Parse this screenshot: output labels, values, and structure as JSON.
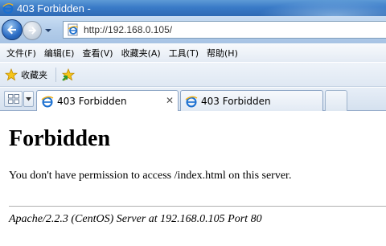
{
  "window": {
    "title": "403 Forbidden -"
  },
  "navigation": {
    "url": "http://192.168.0.105/"
  },
  "menu": {
    "items": [
      "文件(F)",
      "编辑(E)",
      "查看(V)",
      "收藏夹(A)",
      "工具(T)",
      "帮助(H)"
    ]
  },
  "favorites": {
    "label": "收藏夹"
  },
  "tabs": [
    {
      "label": "403 Forbidden",
      "active": true
    },
    {
      "label": "403 Forbidden",
      "active": false
    }
  ],
  "page": {
    "heading": "Forbidden",
    "message": "You don't have permission to access /index.html on this server.",
    "server_signature": "Apache/2.2.3 (CentOS) Server at 192.168.0.105 Port 80"
  },
  "colors": {
    "title_bar": "#3a7bc8",
    "toolbar": "#b3cdea",
    "tab_border": "#8ba4c4"
  },
  "icons": {
    "title": "ie-logo-icon",
    "back": "back-arrow-icon",
    "forward": "forward-arrow-icon",
    "favorites": "star-icon",
    "add_favorite": "add-favorite-icon",
    "quick_tabs": "quick-tabs-icon",
    "tab_close": "close-icon"
  }
}
